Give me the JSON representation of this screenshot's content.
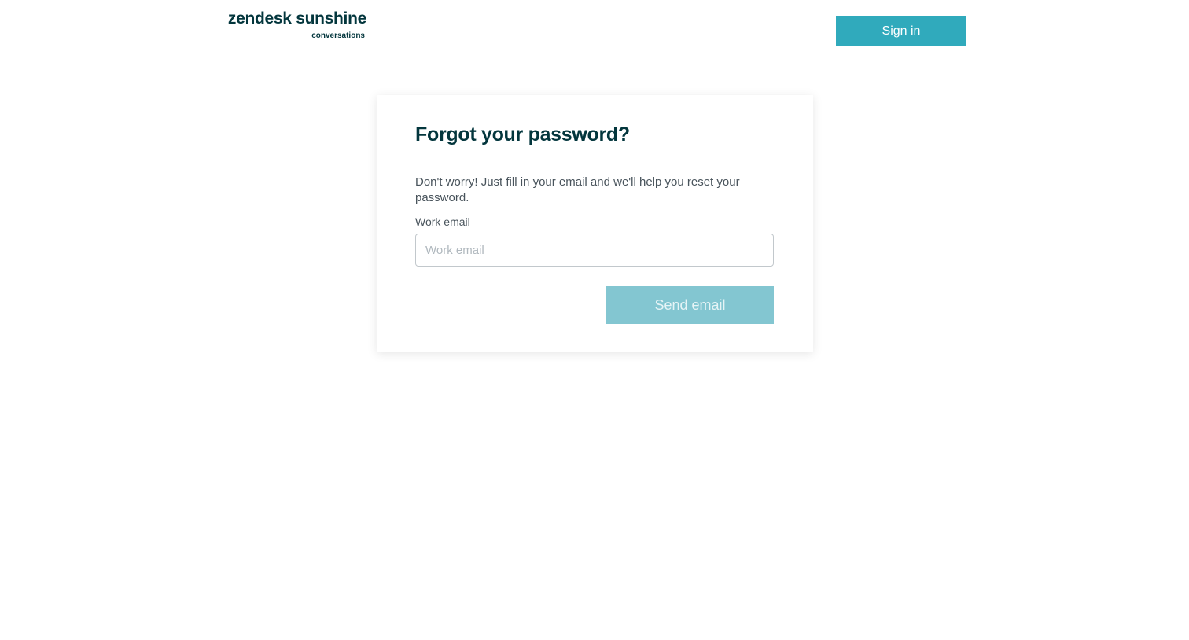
{
  "header": {
    "logo": {
      "main": "zendesk sunshine",
      "sub": "conversations"
    },
    "signin_label": "Sign in"
  },
  "card": {
    "title": "Forgot your password?",
    "description": "Don't worry! Just fill in your email and we'll help you reset your password.",
    "email_field": {
      "label": "Work email",
      "placeholder": "Work email",
      "value": ""
    },
    "send_label": "Send email",
    "send_disabled": true
  },
  "colors": {
    "brand_dark": "#03363d",
    "accent": "#30aabc",
    "accent_disabled": "#83c6d1",
    "text": "#49545c"
  }
}
